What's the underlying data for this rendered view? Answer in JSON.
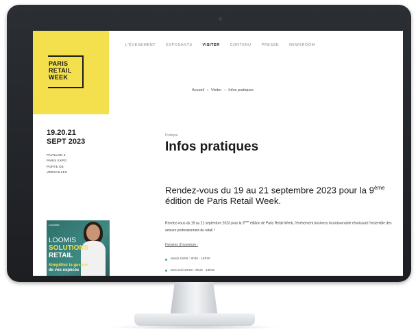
{
  "logo": {
    "line1": "PARIS",
    "line2": "RETAIL",
    "line3": "WEEK",
    "bg_color": "#f4e04d"
  },
  "nav": {
    "items": [
      {
        "label": "L'ÉVÉNEMENT"
      },
      {
        "label": "EXPOSANTS"
      },
      {
        "label": "VISITER"
      },
      {
        "label": "CONTENU"
      },
      {
        "label": "PRESSE"
      },
      {
        "label": "NEWSROOM"
      }
    ],
    "active": "VISITER"
  },
  "breadcrumb": {
    "home": "Accueil",
    "sep": "›",
    "section": "Visiter",
    "current": "Infos pratiques"
  },
  "event": {
    "dates_line1": "19.20.21",
    "dates_line2": "SEPT 2023",
    "venue_line1": "PAVILLON 4",
    "venue_line2": "PARIS EXPO",
    "venue_line3": "PORTE DE",
    "venue_line4": "VERSAILLES"
  },
  "ad": {
    "brand": "LOOMIS",
    "line1": "LOOMIS",
    "line2": "SOLUTIONS",
    "line3": "RETAIL",
    "line4": "Simplifiez la gestion",
    "line5": "de vos espèces"
  },
  "page": {
    "kicker": "Pratique",
    "title": "Infos pratiques",
    "lead_before": "Rendez-vous du 19 au 21 septembre 2023 pour la 9",
    "lead_sup": "ème",
    "lead_after": " édition de Paris Retail Week.",
    "body_before": "Rendez-vous du 19 au 21 septembre 2023 pour la 9",
    "body_sup": "ème",
    "body_after": " édition de Paris Retail Week, l'événement business incontournable réunissant l'ensemble des acteurs professionnels du retail !",
    "hours_label": "Horaires d'ouverture :",
    "hours": [
      {
        "text": "Mardi 19/09 : 9h30 - 18h30"
      },
      {
        "text": "Mercredi 20/09 : 9h30 - 18h30"
      }
    ]
  },
  "colors": {
    "accent_yellow": "#f4e04d",
    "bullet_green": "#3da88f",
    "monitor": "#1c1e22"
  }
}
